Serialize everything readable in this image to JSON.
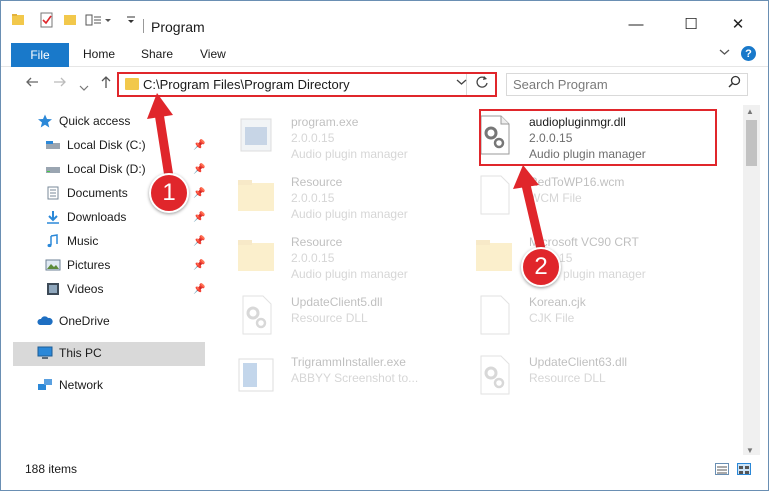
{
  "titlebar": {
    "title": "Program",
    "minimize_glyph": "—",
    "maximize_glyph": "☐",
    "close_glyph": "✕"
  },
  "ribbon": {
    "tabs": [
      "File",
      "Home",
      "Share",
      "View"
    ],
    "help_glyph": "?"
  },
  "address": {
    "path": "C:\\Program Files\\Program Directory"
  },
  "search": {
    "placeholder": "Search Program"
  },
  "navpane": {
    "items": [
      {
        "label": "Quick access",
        "icon": "star-icon",
        "pinned": false
      },
      {
        "label": "Local Disk (C:)",
        "icon": "drive-icon",
        "pinned": true
      },
      {
        "label": "Local Disk (D:)",
        "icon": "drive-icon",
        "pinned": true
      },
      {
        "label": "Documents",
        "icon": "documents-icon",
        "pinned": true
      },
      {
        "label": "Downloads",
        "icon": "download-icon",
        "pinned": true
      },
      {
        "label": "Music",
        "icon": "music-icon",
        "pinned": true
      },
      {
        "label": "Pictures",
        "icon": "pictures-icon",
        "pinned": true
      },
      {
        "label": "Videos",
        "icon": "videos-icon",
        "pinned": true
      },
      {
        "label": "OneDrive",
        "icon": "cloud-icon",
        "pinned": false
      },
      {
        "label": "This PC",
        "icon": "computer-icon",
        "pinned": false,
        "selected": true
      },
      {
        "label": "Network",
        "icon": "network-icon",
        "pinned": false
      }
    ]
  },
  "files": [
    {
      "name": "program.exe",
      "version": "2.0.0.15",
      "desc": "Audio plugin manager",
      "icon": "exe-icon",
      "faded": true
    },
    {
      "name": "audiopluginmgr.dll",
      "version": "2.0.0.15",
      "desc": "Audio plugin manager",
      "icon": "dll-gear-icon",
      "faded": false,
      "highlighted": true
    },
    {
      "name": "Resource",
      "version": "2.0.0.15",
      "desc": "Audio plugin manager",
      "icon": "folder-icon",
      "faded": true
    },
    {
      "name": "RedToWP16.wcm",
      "version": "WCM File",
      "desc": "",
      "icon": "file-icon",
      "faded": true
    },
    {
      "name": "Resource",
      "version": "2.0.0.15",
      "desc": "Audio plugin manager",
      "icon": "folder-icon",
      "faded": true
    },
    {
      "name": "Microsoft VC90 CRT",
      "version": "2.0.0.15",
      "desc": "Audio plugin manager",
      "icon": "folder-icon",
      "faded": true
    },
    {
      "name": "UpdateClient5.dll",
      "version": "Resource DLL",
      "desc": "",
      "icon": "dll-gear-icon",
      "faded": true
    },
    {
      "name": "Korean.cjk",
      "version": "CJK File",
      "desc": "",
      "icon": "file-icon",
      "faded": true
    },
    {
      "name": "TrigrammInstaller.exe",
      "version": "ABBYY Screenshot to...",
      "desc": "",
      "icon": "installer-icon",
      "faded": true
    },
    {
      "name": "UpdateClient63.dll",
      "version": "Resource DLL",
      "desc": "",
      "icon": "dll-gear-icon",
      "faded": true
    }
  ],
  "status": {
    "item_count": "188 items"
  },
  "annotations": {
    "step1": "1",
    "step2": "2",
    "color": "#e0262b"
  }
}
